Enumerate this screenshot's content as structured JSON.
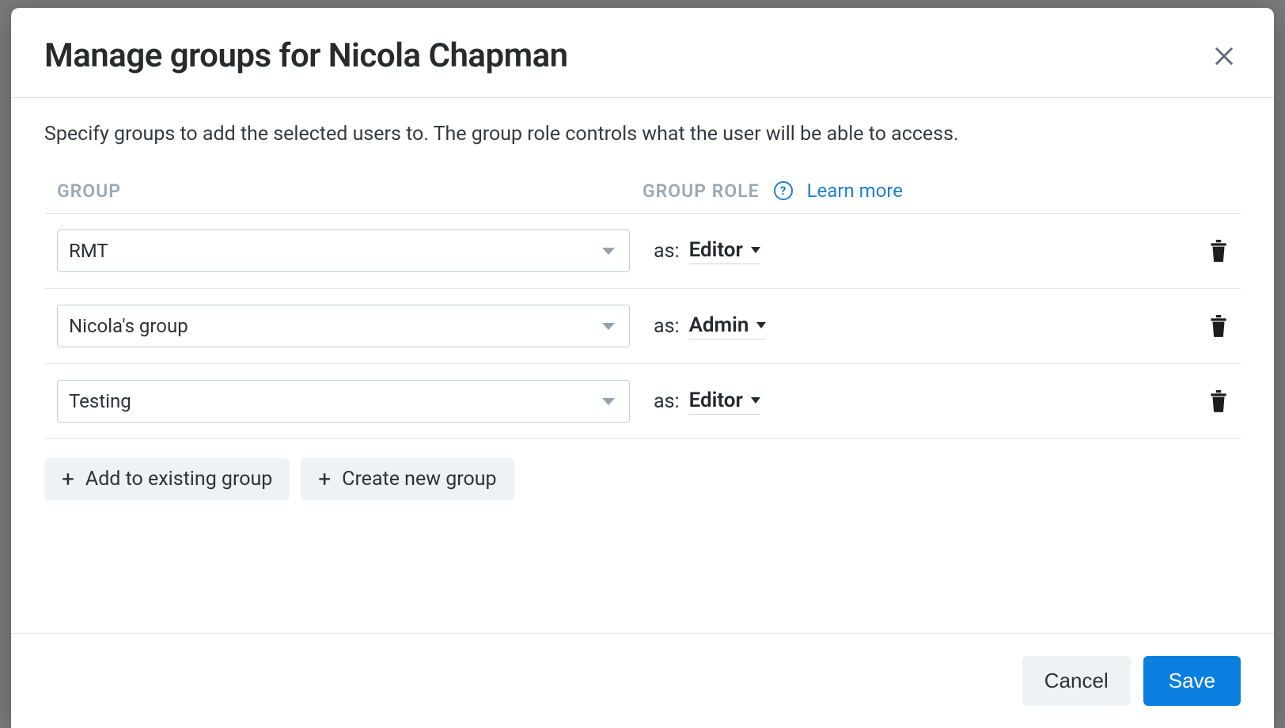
{
  "modal": {
    "title": "Manage groups for Nicola Chapman",
    "description": "Specify groups to add the selected users to. The group role controls what the user will be able to access.",
    "columns": {
      "group": "GROUP",
      "role": "GROUP ROLE"
    },
    "learn_more": "Learn more",
    "rows": [
      {
        "group": "RMT",
        "as_label": "as:",
        "role": "Editor"
      },
      {
        "group": "Nicola's group",
        "as_label": "as:",
        "role": "Admin"
      },
      {
        "group": "Testing",
        "as_label": "as:",
        "role": "Editor"
      }
    ],
    "add_existing": "Add to existing group",
    "create_new": "Create new group",
    "cancel": "Cancel",
    "save": "Save"
  }
}
